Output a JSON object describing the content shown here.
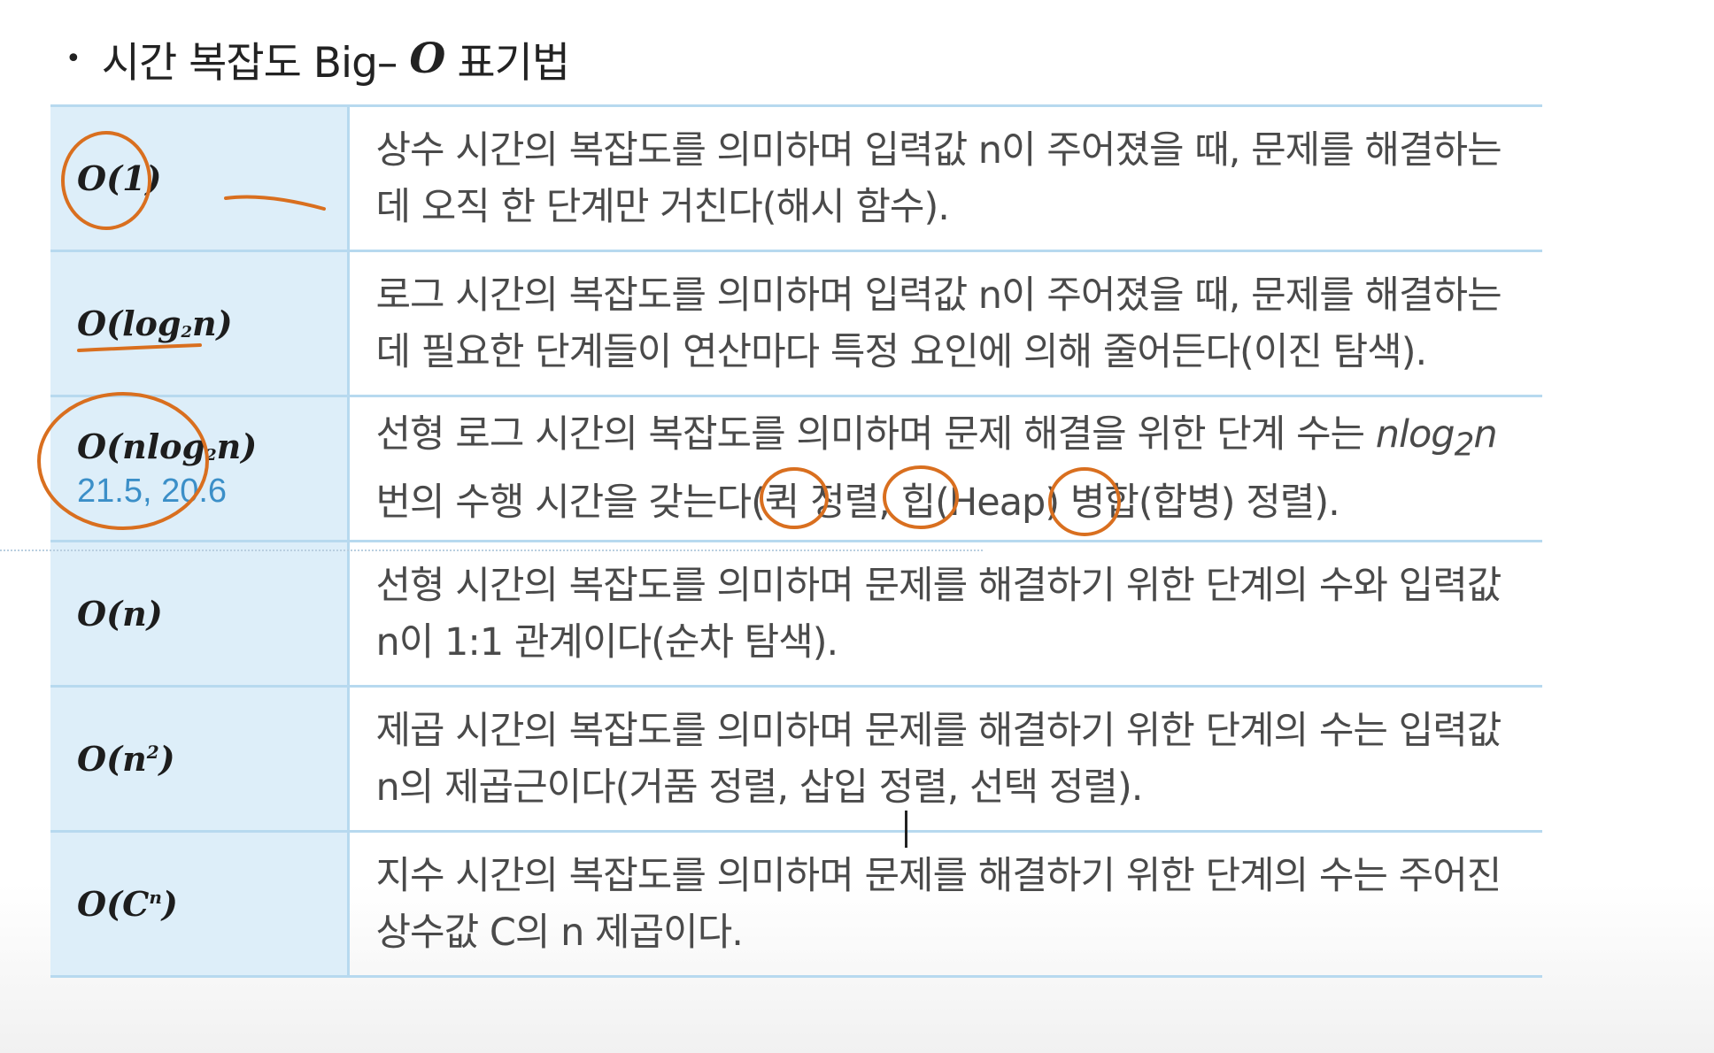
{
  "heading": {
    "bullet": "•",
    "text_before": "시간 복잡도 Big–",
    "big_o": "O",
    "text_after": "표기법"
  },
  "rows": [
    {
      "notation_main": "O(1)",
      "description": "상수 시간의 복잡도를 의미하며 입력값 n이 주어졌을 때, 문제를 해결하는데 오직 한 단계만 거친다(해시 함수)."
    },
    {
      "notation_main": "O(log",
      "notation_sub": "2",
      "notation_tail": "n)",
      "description": "로그 시간의 복잡도를 의미하며 입력값 n이 주어졌을 때, 문제를 해결하는데 필요한 단계들이 연산마다 특정 요인에 의해 줄어든다(이진 탐색)."
    },
    {
      "notation_main": "O(nlog",
      "notation_sub": "2",
      "notation_tail": "n)",
      "note": "21.5, 20.6",
      "description_before": "선형 로그 시간의 복잡도를 의미하며 문제 해결을 위한 단계 수는 ",
      "description_math": "nlog",
      "description_math_sub": "2",
      "description_math_tail": "n",
      "description_after": " 번의 수행 시간을 갖는다(퀵 정렬, 힙(Heap) 병합(합병) 정렬)."
    },
    {
      "notation_main": "O(n)",
      "description": "선형 시간의 복잡도를 의미하며 문제를 해결하기 위한 단계의 수와 입력값 n이 1:1 관계이다(순차 탐색)."
    },
    {
      "notation_main": "O(n",
      "notation_sup": "2",
      "notation_tail": ")",
      "description": "제곱 시간의 복잡도를 의미하며 문제를 해결하기 위한 단계의 수는 입력값 n의 제곱근이다(거품 정렬, 삽입 정렬, 선택 정렬)."
    },
    {
      "notation_main": "O(C",
      "notation_sup": "n",
      "notation_tail": ")",
      "description": "지수 시간의 복잡도를 의미하며 문제를 해결하기 위한 단계의 수는 주어진 상수값 C의 n 제곱이다."
    }
  ],
  "colors": {
    "header_cell": "#ddeef9",
    "row_border": "#b7d9ef",
    "annotation_ink": "#d96f1f",
    "note_text": "#3b8fc8"
  }
}
